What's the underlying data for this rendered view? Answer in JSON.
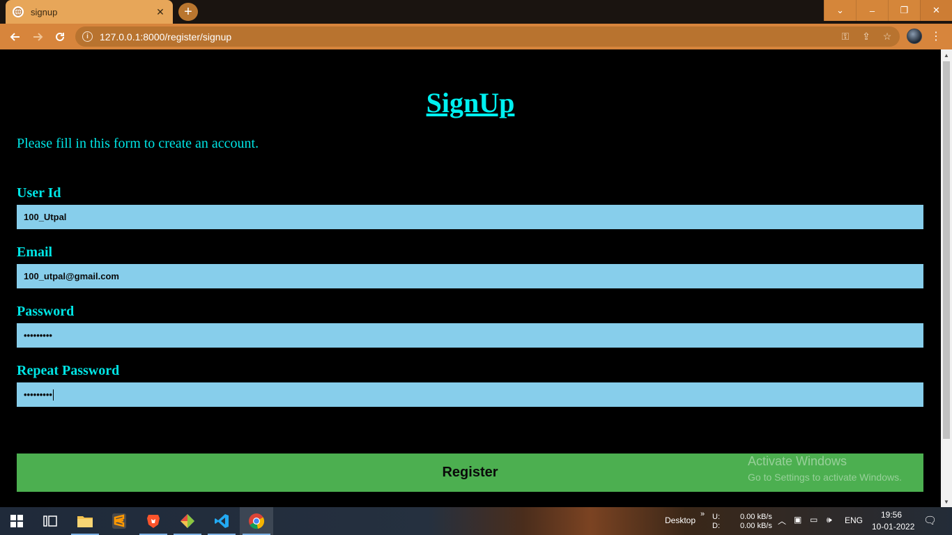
{
  "browser": {
    "tab_title": "signup",
    "tab_close": "✕",
    "new_tab": "+",
    "url": "127.0.0.1:8000/register/signup",
    "window_controls": [
      "⌄",
      "–",
      "❐",
      "✕"
    ]
  },
  "page": {
    "heading": "SignUp",
    "intro": "Please fill in this form to create an account.",
    "fields": [
      {
        "label": "User Id",
        "value": "100_Utpal"
      },
      {
        "label": "Email",
        "value": "100_utpal@gmail.com"
      },
      {
        "label": "Password",
        "value": "•••••••••"
      },
      {
        "label": "Repeat Password",
        "value": "•••••••••"
      }
    ],
    "register_label": "Register",
    "watermark": {
      "line1": "Activate Windows",
      "line2": "Go to Settings to activate Windows."
    }
  },
  "taskbar": {
    "desktop_label": "Desktop",
    "chevron": "»",
    "net_up_label": "U:",
    "net_down_label": "D:",
    "net_up": "0.00 kB/s",
    "net_down": "0.00 kB/s",
    "lang": "ENG",
    "time": "19:56",
    "date": "10-01-2022"
  },
  "colors": {
    "accent_cyan": "#00e5e5",
    "field_bg": "#87ceeb",
    "register_bg": "#4caf50",
    "browser_frame": "#d7853c"
  }
}
